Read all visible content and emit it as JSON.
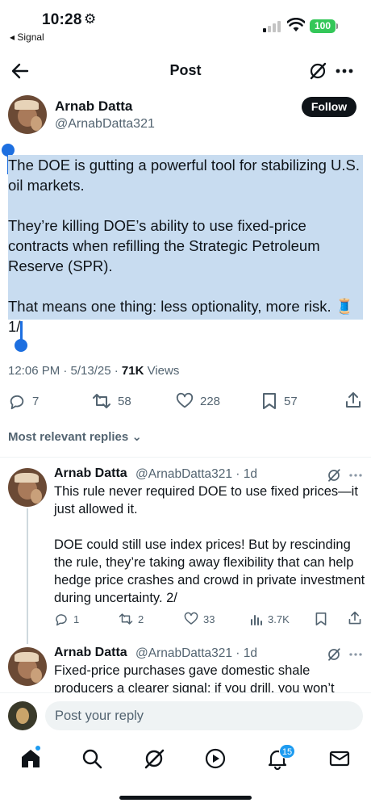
{
  "status_bar": {
    "time": "10:28",
    "back_app": "◂ Signal",
    "battery": "100"
  },
  "header": {
    "title": "Post"
  },
  "author": {
    "name": "Arnab Datta",
    "handle": "@ArnabDatta321",
    "follow_label": "Follow"
  },
  "post": {
    "text": "The DOE is gutting a powerful tool for stabilizing U.S. oil markets.\n\nThey’re killing DOE’s ability to use fixed-price contracts when refilling the Strategic Petroleum Reserve (SPR).\n\nThat means one thing: less optionality, more risk. 🧵 1/",
    "timestamp": "12:06 PM · 5/13/25 · ",
    "views_count": "71K",
    "views_label": " Views",
    "replies": "7",
    "reposts": "58",
    "likes": "228",
    "bookmarks": "57"
  },
  "replies_section": {
    "title": "Most relevant replies ⌄"
  },
  "replies": [
    {
      "name": "Arnab Datta",
      "handle": "@ArnabDatta321 · 1d",
      "text": "This rule never required DOE to use fixed prices—it just allowed it.\n\nDOE could still use index prices! But by rescinding the rule, they’re taking away flexibility that can help hedge price crashes and crowd in private investment during uncertainty. 2/",
      "replies": "1",
      "reposts": "2",
      "likes": "33",
      "views": "3.7K"
    },
    {
      "name": "Arnab Datta",
      "handle": "@ArnabDatta321 · 1d",
      "text": "Fixed-price purchases gave domestic shale producers a clearer signal: if you drill, you won’t"
    }
  ],
  "composer": {
    "placeholder": "Post your reply"
  },
  "nav": {
    "notifications_badge": "15"
  },
  "colors": {
    "accent": "#1d9bf0",
    "selection": "#c8dcf0",
    "text": "#0f1419",
    "muted": "#536471"
  }
}
